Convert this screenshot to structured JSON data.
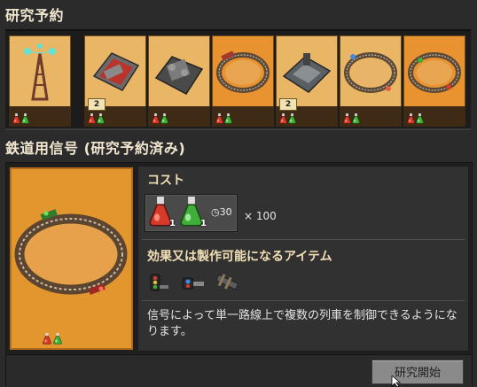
{
  "research_queue": {
    "title": "研究予約",
    "items": [
      {
        "name": "radar-tower",
        "badge": "",
        "flasks": [
          "red",
          "green"
        ]
      },
      {
        "name": "red-train-car",
        "badge": "2",
        "flasks": [
          "red",
          "green"
        ]
      },
      {
        "name": "engine-machine",
        "badge": "",
        "flasks": [
          "red",
          "green"
        ]
      },
      {
        "name": "rail-loop",
        "badge": "",
        "flasks": [
          "red",
          "green"
        ]
      },
      {
        "name": "stone-bunker",
        "badge": "2",
        "flasks": [
          "red",
          "green"
        ]
      },
      {
        "name": "rail-loop-light",
        "badge": "",
        "flasks": [
          "red",
          "green"
        ]
      },
      {
        "name": "rail-loop-signal",
        "badge": "",
        "flasks": [
          "red",
          "green"
        ]
      }
    ]
  },
  "detail": {
    "title": "鉄道用信号 (研究予約済み)",
    "cost_heading": "コスト",
    "cost": {
      "items": [
        {
          "color": "red",
          "count": "1"
        },
        {
          "color": "green",
          "count": "1"
        }
      ],
      "time": "30",
      "multiplier": "× 100"
    },
    "effects_heading": "効果又は製作可能になるアイテム",
    "unlocks": [
      "rail-signal-icon",
      "chain-signal-icon",
      "rail-tool-icon"
    ],
    "description": "信号によって単一路線上で複数の列車を制御できるようになります。",
    "flasks": [
      "red",
      "green"
    ],
    "start_button": "研究開始"
  },
  "colors": {
    "accent": "#e4962e",
    "heading": "#f3dfb6",
    "red_flask": "#d63b2a",
    "green_flask": "#3fae3a"
  }
}
